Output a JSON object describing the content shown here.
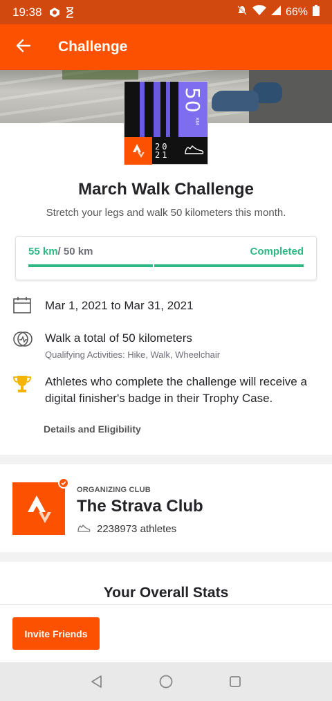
{
  "status_bar": {
    "time": "19:38",
    "battery": "66%",
    "icons": [
      "notification-icon",
      "hourglass-icon",
      "mute-icon",
      "wifi-icon",
      "signal-icon",
      "battery-icon"
    ]
  },
  "app_bar": {
    "title": "Challenge",
    "back_icon": "arrow-left-icon",
    "color": "#fc5200"
  },
  "badge": {
    "distance": "50",
    "unit": "KM",
    "year": "20 21"
  },
  "challenge": {
    "title": "March Walk Challenge",
    "description": "Stretch your legs and walk 50 kilometers this month."
  },
  "progress": {
    "current": "55 km",
    "target": "/ 50 km",
    "status": "Completed",
    "fraction": 1.0,
    "color": "#2db885"
  },
  "info": {
    "dates": "Mar 1, 2021 to Mar 31, 2021",
    "goal": "Walk a total of 50 kilometers",
    "qualifying": "Qualifying Activities: Hike, Walk, Wheelchair",
    "reward": "Athletes who complete the challenge will receive a digital finisher's badge in their Trophy Case.",
    "details_link": "Details and Eligibility"
  },
  "club": {
    "label": "ORGANIZING CLUB",
    "name": "The Strava Club",
    "athletes": "2238973 athletes"
  },
  "stats": {
    "title": "Your Overall Stats"
  },
  "actions": {
    "invite": "Invite Friends"
  },
  "nav": {
    "icons": [
      "back-triangle-icon",
      "home-circle-icon",
      "recents-square-icon"
    ]
  }
}
